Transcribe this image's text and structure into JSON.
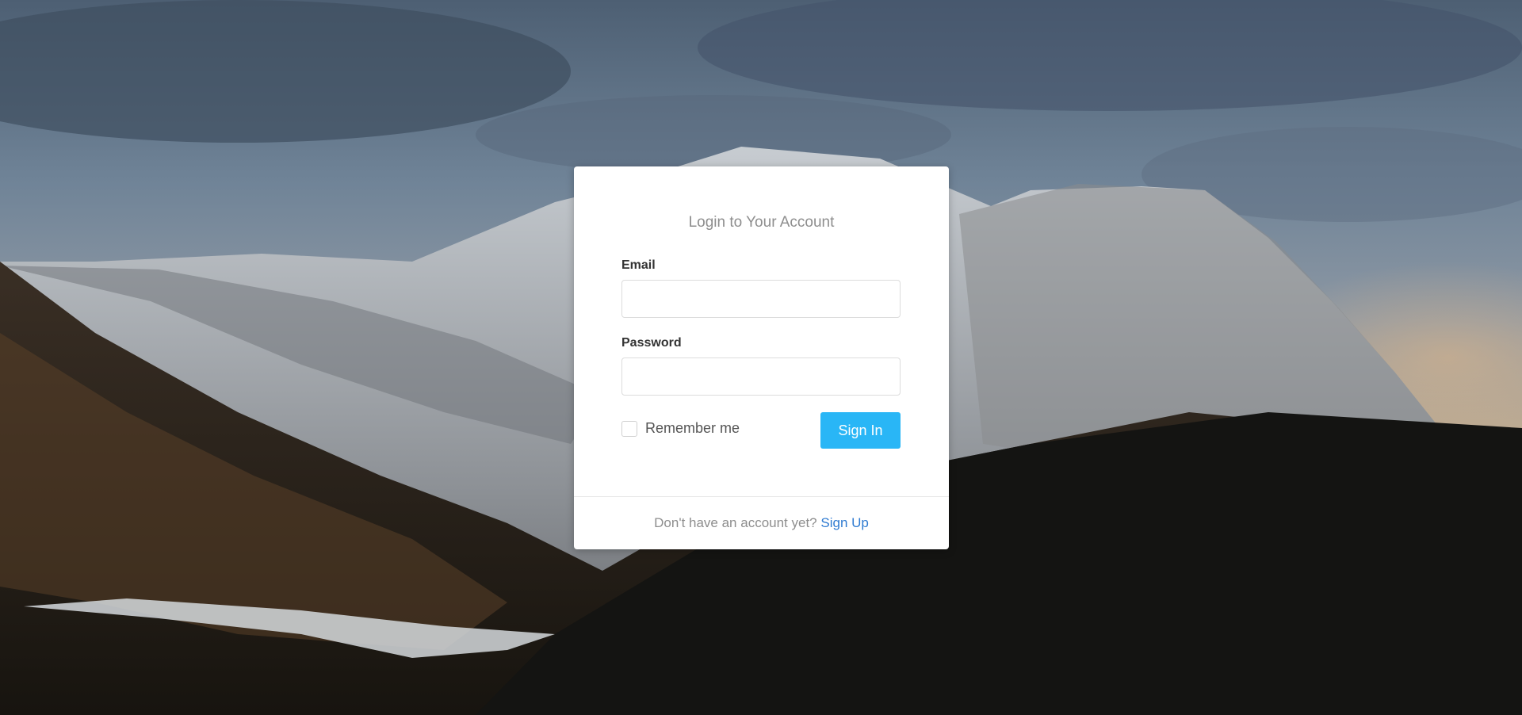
{
  "login": {
    "title": "Login to Your Account",
    "email_label": "Email",
    "email_value": "",
    "password_label": "Password",
    "password_value": "",
    "remember_label": "Remember me",
    "remember_checked": false,
    "signin_label": "Sign In",
    "footer_text": "Don't have an account yet?",
    "signup_label": "Sign Up"
  },
  "colors": {
    "accent": "#29b6f6",
    "link": "#2f7bd1"
  }
}
